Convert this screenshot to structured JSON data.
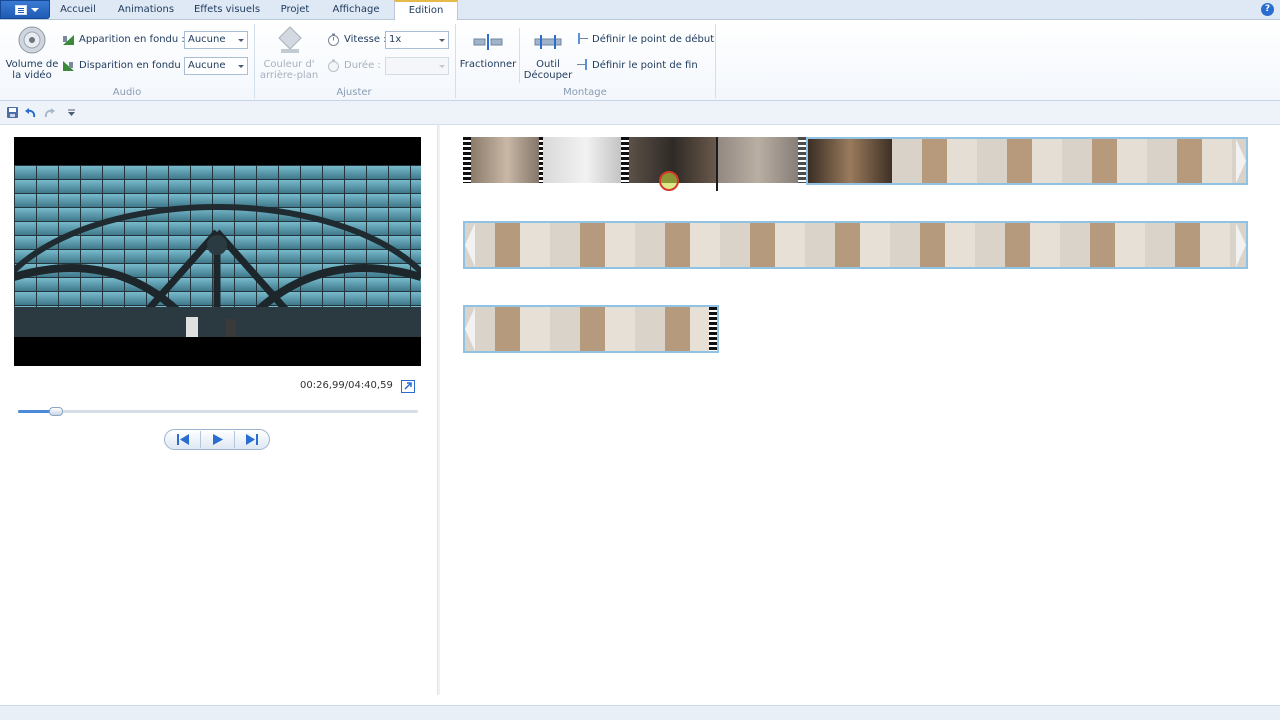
{
  "ribbon": {
    "tabs": [
      "Accueil",
      "Animations",
      "Effets visuels",
      "Projet",
      "Affichage",
      "Edition"
    ],
    "active_tab": "Edition",
    "audio": {
      "volume_label_line1": "Volume de",
      "volume_label_line2": "la vidéo",
      "fade_in_label": "Apparition en fondu :",
      "fade_in_value": "Aucune",
      "fade_out_label": "Disparition en fondu :",
      "fade_out_value": "Aucune",
      "group_label": "Audio"
    },
    "ajuster": {
      "bg_color_line1": "Couleur d'",
      "bg_color_line2": "arrière-plan",
      "speed_label": "Vitesse :",
      "speed_value": "1x",
      "duration_label": "Durée :",
      "duration_value": "",
      "group_label": "Ajuster"
    },
    "montage": {
      "split_label": "Fractionner",
      "trim_line1": "Outil",
      "trim_line2": "Découper",
      "set_start": "Définir le point de début",
      "set_end": "Définir le point de fin",
      "group_label": "Montage"
    }
  },
  "player": {
    "time": "00:26,99/04:40,59",
    "progress": 0.096
  },
  "colors": {
    "accent": "#2a6ccf",
    "selection": "#8fc2e3",
    "tab_highlight": "#e6b94a"
  }
}
